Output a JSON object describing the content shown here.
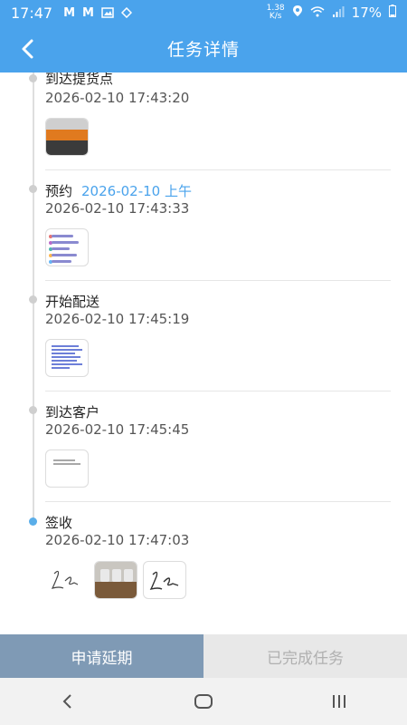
{
  "status_bar": {
    "time": "17:47",
    "left_icons": [
      "gmail-icon",
      "gmail-icon",
      "image-icon",
      "diamond-icon"
    ],
    "network_speed_top": "1.38",
    "network_speed_bottom": "K/s",
    "battery": "17%"
  },
  "header": {
    "title": "任务详情",
    "back_icon": "chevron-left-icon"
  },
  "colors": {
    "primary": "#4aa3ec",
    "extend_button": "#7f9ab5",
    "done_button_bg": "#e8e8e8"
  },
  "events": [
    {
      "title": "到达提货点",
      "extra": "",
      "time": "2026-02-10 17:43:20",
      "thumbs": [
        "photo-thumbnail"
      ]
    },
    {
      "title": "预约",
      "extra": "2026-02-10 上午",
      "time": "2026-02-10 17:43:33",
      "thumbs": [
        "screenshot-thumbnail"
      ]
    },
    {
      "title": "开始配送",
      "extra": "",
      "time": "2026-02-10 17:45:19",
      "thumbs": [
        "document-thumbnail"
      ]
    },
    {
      "title": "到达客户",
      "extra": "",
      "time": "2026-02-10 17:45:45",
      "thumbs": [
        "document-thumbnail"
      ]
    },
    {
      "title": "签收",
      "extra": "",
      "time": "2026-02-10 17:47:03",
      "thumbs": [
        "signature-image",
        "photo-thumbnail",
        "signature-thumbnail"
      ]
    }
  ],
  "actions": {
    "extend_label": "申请延期",
    "done_label": "已完成任务"
  },
  "nav": [
    "back-icon",
    "home-icon",
    "recents-icon"
  ]
}
